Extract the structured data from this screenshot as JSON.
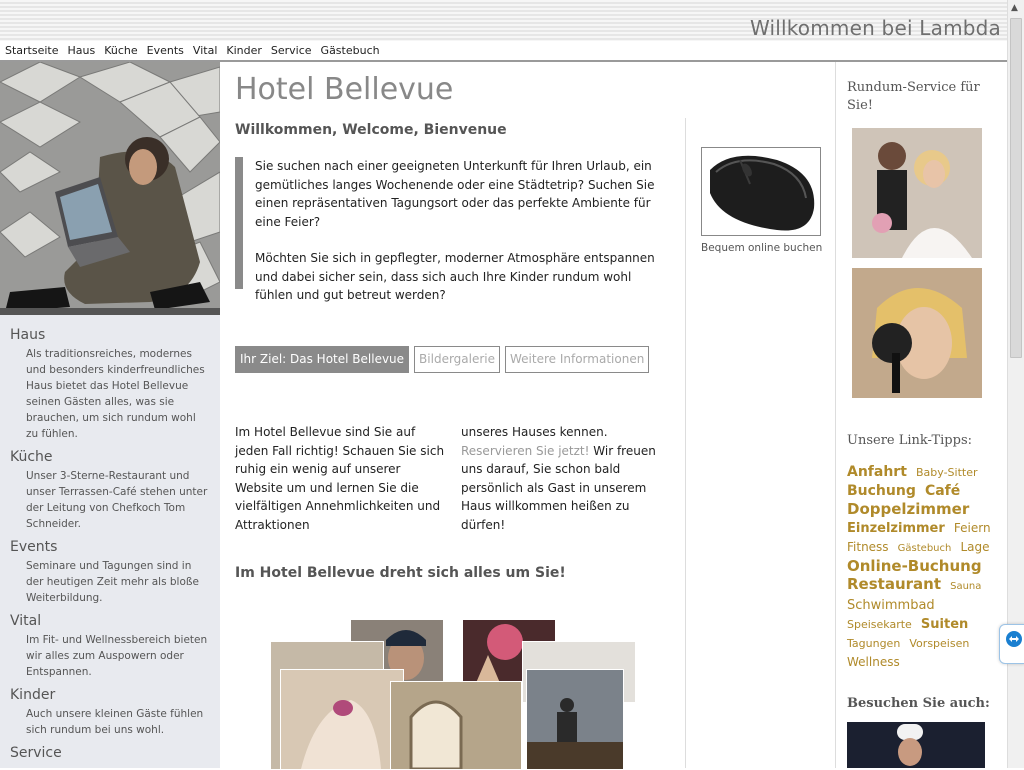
{
  "header": {
    "brand": "Willkommen bei Lambda"
  },
  "nav": {
    "items": [
      "Startseite",
      "Haus",
      "Küche",
      "Events",
      "Vital",
      "Kinder",
      "Service",
      "Gästebuch"
    ]
  },
  "sidebar": {
    "sections": [
      {
        "title": "Haus",
        "text": "Als traditionsreiches, modernes und besonders kinderfreundliches Haus bietet das Hotel Bellevue seinen Gästen alles, was sie brauchen, um sich rundum wohl zu fühlen."
      },
      {
        "title": "Küche",
        "text": "Unser 3-Sterne-Restaurant und unser Terrassen-Café stehen unter der Leitung von Chefkoch Tom Schneider."
      },
      {
        "title": "Events",
        "text": "Seminare und Tagungen sind in der heutigen Zeit mehr als bloße Weiterbildung."
      },
      {
        "title": "Vital",
        "text": "Im Fit- und Wellnessbereich bieten wir alles zum Auspowern oder Entspannen."
      },
      {
        "title": "Kinder",
        "text": "Auch unsere kleinen Gäste fühlen sich rundum bei uns wohl."
      },
      {
        "title": "Service",
        "text": ""
      }
    ]
  },
  "main": {
    "title": "Hotel Bellevue",
    "subtitle": "Willkommen, Welcome, Bienvenue",
    "quote_p1": "Sie suchen nach einer geeigneten Unterkunft für Ihren Urlaub, ein gemütliches langes Wochenende oder eine Städtetrip? Suchen Sie einen repräsentativen Tagungsort oder das perfekte Ambiente für eine Feier?",
    "quote_p2": "Möchten Sie sich in gepflegter, moderner Atmosphäre entspannen und dabei sicher sein, dass sich auch Ihre Kinder rundum wohl fühlen und gut betreut werden?",
    "tabs": [
      "Ihr Ziel: Das Hotel Bellevue",
      "Bildergalerie",
      "Weitere Informationen"
    ],
    "col1": "Im Hotel Bellevue sind Sie auf jeden Fall richtig! Schauen Sie sich ruhig ein wenig auf unserer Website um und lernen Sie die vielfältigen Annehmlichkeiten und Attraktionen",
    "col2_pre": "unseres Hauses kennen.",
    "col2_link": "Reservieren Sie jetzt!",
    "col2_post": "Wir freuen uns darauf, Sie schon bald persönlich als Gast in unserem Haus willkommen heißen zu dürfen!",
    "heading2": "Im Hotel Bellevue dreht sich alles um Sie!",
    "mouse_caption": "Bequem online buchen"
  },
  "right": {
    "heading1": "Rundum-Service für Sie!",
    "heading2": "Unsere Link-Tipps:",
    "heading3": "Besuchen Sie auch:",
    "tags": [
      {
        "label": "Anfahrt",
        "size": 14,
        "bold": true
      },
      {
        "label": "Baby-Sitter",
        "size": 11,
        "bold": false
      },
      {
        "label": "Buchung",
        "size": 14,
        "bold": true
      },
      {
        "label": "Café",
        "size": 14,
        "bold": true
      },
      {
        "label": "Doppelzimmer",
        "size": 15,
        "bold": true
      },
      {
        "label": "Einzelzimmer",
        "size": 13,
        "bold": true
      },
      {
        "label": "Feiern",
        "size": 12,
        "bold": false
      },
      {
        "label": "Fitness",
        "size": 12,
        "bold": false
      },
      {
        "label": "Gästebuch",
        "size": 10,
        "bold": false
      },
      {
        "label": "Lage",
        "size": 12,
        "bold": false
      },
      {
        "label": "Online-Buchung",
        "size": 15,
        "bold": true
      },
      {
        "label": "Restaurant",
        "size": 15,
        "bold": true
      },
      {
        "label": "Sauna",
        "size": 10,
        "bold": false
      },
      {
        "label": "Schwimmbad",
        "size": 13,
        "bold": false
      },
      {
        "label": "Speisekarte",
        "size": 11,
        "bold": false
      },
      {
        "label": "Suiten",
        "size": 13,
        "bold": true
      },
      {
        "label": "Tagungen",
        "size": 11,
        "bold": false
      },
      {
        "label": "Vorspeisen",
        "size": 11,
        "bold": false
      },
      {
        "label": "Wellness",
        "size": 12,
        "bold": false
      }
    ]
  },
  "colors": {
    "accent": "#8a8a8a",
    "tag": "#b08a2a",
    "link": "#999999"
  }
}
